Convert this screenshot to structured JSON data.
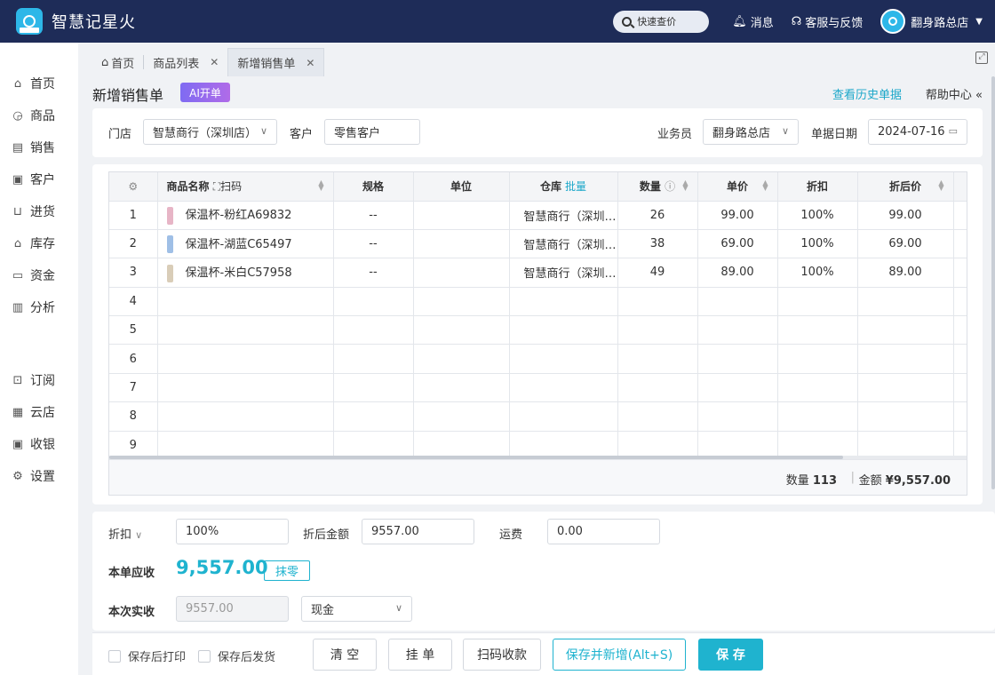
{
  "app": {
    "title": "智慧记星火"
  },
  "header": {
    "search_label": "快速查价",
    "messages_label": "消息",
    "support_label": "客服与反馈",
    "user_name": "翻身路总店"
  },
  "sidebar": {
    "items": [
      {
        "label": "首页",
        "icon": "home-icon"
      },
      {
        "label": "商品",
        "icon": "bag-icon"
      },
      {
        "label": "销售",
        "icon": "receipt-icon"
      },
      {
        "label": "客户",
        "icon": "contact-icon"
      },
      {
        "label": "进货",
        "icon": "stock-in-icon"
      },
      {
        "label": "库存",
        "icon": "warehouse-icon"
      },
      {
        "label": "资金",
        "icon": "wallet-icon"
      },
      {
        "label": "分析",
        "icon": "chart-icon"
      },
      {
        "label": "订阅",
        "icon": "subscribe-icon"
      },
      {
        "label": "云店",
        "icon": "store-icon"
      },
      {
        "label": "收银",
        "icon": "cashier-icon"
      },
      {
        "label": "设置",
        "icon": "gear-icon"
      }
    ]
  },
  "tabs": [
    {
      "label": "首页"
    },
    {
      "label": "商品列表"
    },
    {
      "label": "新增销售单"
    }
  ],
  "page": {
    "title": "新增销售单",
    "ai_badge": "AI开单",
    "history_link": "查看历史单据",
    "help_link": "帮助中心"
  },
  "filters": {
    "store_label": "门店",
    "store_value": "智慧商行（深圳店）",
    "customer_label": "客户",
    "customer_value": "零售客户",
    "salesperson_label": "业务员",
    "salesperson_value": "翻身路总店",
    "date_label": "单据日期",
    "date_value": "2024-07-16"
  },
  "table": {
    "headers": {
      "name": "商品名称",
      "scan": "扫码",
      "spec": "规格",
      "unit": "单位",
      "warehouse": "仓库",
      "batch": "批量",
      "qty": "数量",
      "price": "单价",
      "discount": "折扣",
      "discounted_price": "折后价"
    },
    "rows": [
      {
        "no": "1",
        "name": "保温杯-粉红A69832",
        "spec": "--",
        "unit": "",
        "warehouse": "智慧商行（深圳店）",
        "qty": "26",
        "price": "99.00",
        "discount": "100%",
        "discounted_price": "99.00",
        "thumb_color": "#e7b5c6"
      },
      {
        "no": "2",
        "name": "保温杯-湖蓝C65497",
        "spec": "--",
        "unit": "",
        "warehouse": "智慧商行（深圳店）",
        "qty": "38",
        "price": "69.00",
        "discount": "100%",
        "discounted_price": "69.00",
        "thumb_color": "#9fbfe6"
      },
      {
        "no": "3",
        "name": "保温杯-米白C57958",
        "spec": "--",
        "unit": "",
        "warehouse": "智慧商行（深圳店）",
        "qty": "49",
        "price": "89.00",
        "discount": "100%",
        "discounted_price": "89.00",
        "thumb_color": "#d9cdb8"
      },
      {
        "no": "4"
      },
      {
        "no": "5"
      },
      {
        "no": "6"
      },
      {
        "no": "7"
      },
      {
        "no": "8"
      },
      {
        "no": "9"
      }
    ],
    "footer": {
      "qty_label": "数量",
      "qty_value": "113",
      "amount_label": "金额",
      "amount_value": "¥9,557.00"
    }
  },
  "totals": {
    "discount_label": "折扣",
    "discount_value": "100%",
    "discounted_amount_label": "折后金额",
    "discounted_amount_value": "9557.00",
    "freight_label": "运费",
    "freight_value": "0.00",
    "receivable_label": "本单应收",
    "receivable_value": "9,557.00",
    "round_off_label": "抹零",
    "paid_label": "本次实收",
    "paid_value": "9557.00",
    "payment_method": "现金"
  },
  "footer": {
    "print_after_save": "保存后打印",
    "ship_after_save": "保存后发货",
    "clear": "清 空",
    "hold": "挂 单",
    "scan_pay": "扫码收款",
    "save_new": "保存并新增(Alt+S)",
    "save": "保 存"
  }
}
